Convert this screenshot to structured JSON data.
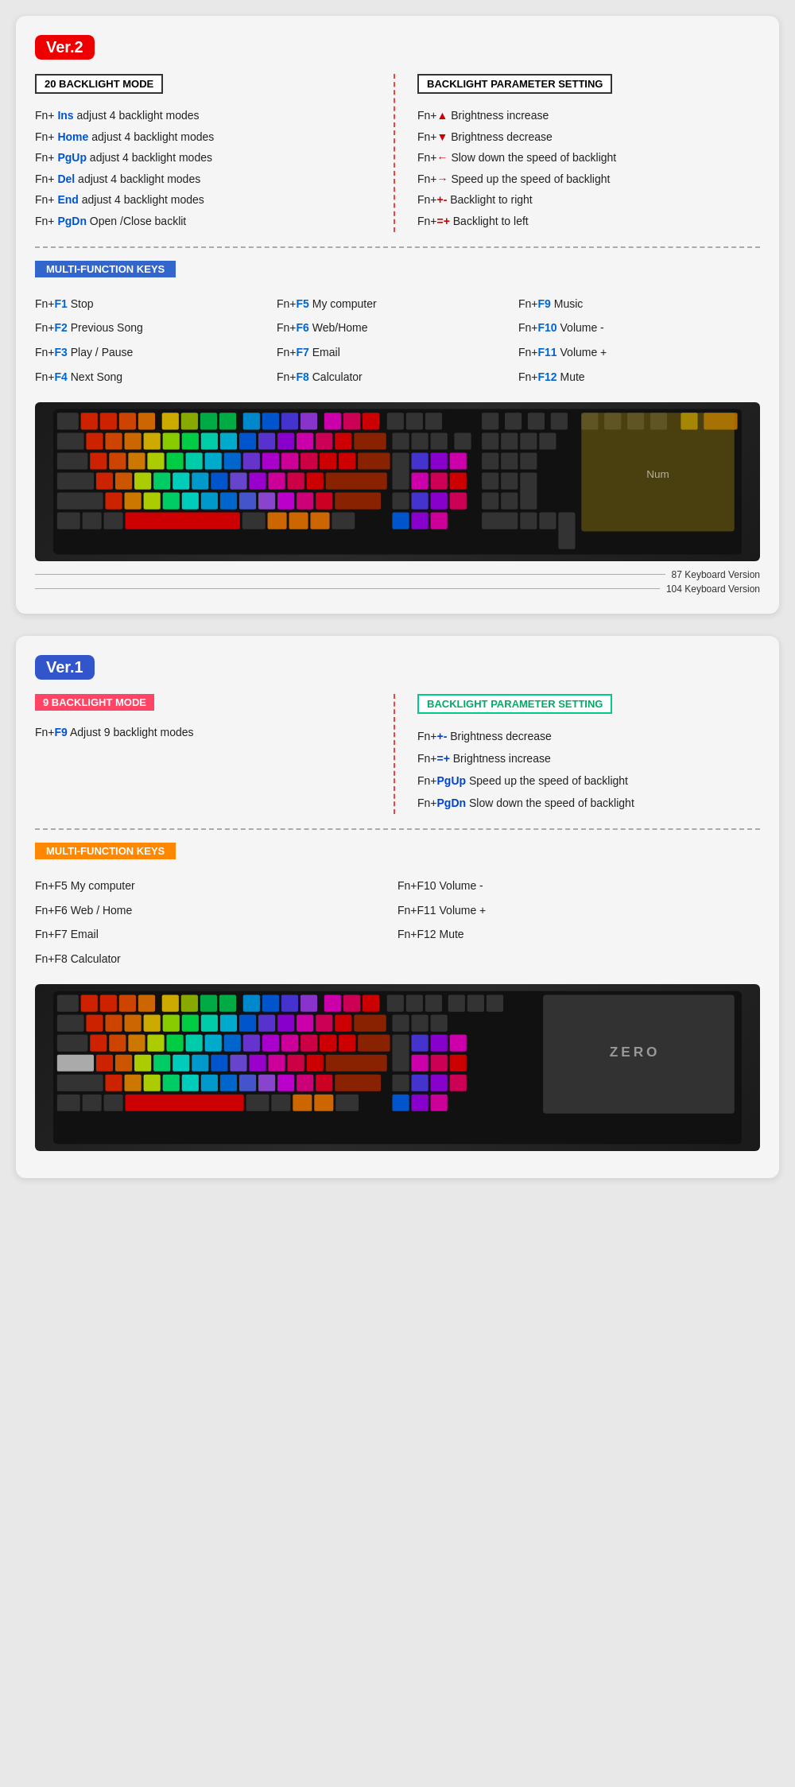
{
  "ver2": {
    "badge": "Ver.2",
    "backlight_section": {
      "header": "20 BACKLIGHT MODE",
      "rows": [
        {
          "prefix": "Fn+",
          "key": "Ins",
          "text": " adjust 4 backlight modes"
        },
        {
          "prefix": "Fn+",
          "key": "Home",
          "text": " adjust 4 backlight modes"
        },
        {
          "prefix": "Fn+",
          "key": "PgUp",
          "text": " adjust 4 backlight modes"
        },
        {
          "prefix": "Fn+",
          "key": "Del",
          "text": "  adjust 4 backlight modes"
        },
        {
          "prefix": "Fn+",
          "key": "End",
          "text": "  adjust 4 backlight modes"
        },
        {
          "prefix": "Fn+",
          "key": "PgDn",
          "text": " Open /Close backlit"
        }
      ]
    },
    "param_section": {
      "header": "BACKLIGHT PARAMETER SETTING",
      "rows": [
        {
          "prefix": "Fn+",
          "icon": "▲",
          "text": "  Brightness increase"
        },
        {
          "prefix": "Fn+",
          "icon": "▼",
          "text": "  Brightness decrease"
        },
        {
          "prefix": "Fn+",
          "icon": "←",
          "text": "  Slow down the speed of backlight"
        },
        {
          "prefix": "Fn+",
          "icon": "→",
          "text": "  Speed up the speed of backlight"
        },
        {
          "prefix": "Fn+",
          "icon": "+-",
          "text": "   Backlight to right"
        },
        {
          "prefix": "Fn+",
          "icon": "=+",
          "text": "   Backlight to left"
        }
      ]
    },
    "multifunction": {
      "header": "MULTI-FUNCTION KEYS",
      "items": [
        {
          "prefix": "Fn+",
          "key": "F1",
          "text": "  Stop"
        },
        {
          "prefix": "Fn+",
          "key": "F5",
          "text": "  My computer"
        },
        {
          "prefix": "Fn+",
          "key": "F9",
          "text": "   Music"
        },
        {
          "prefix": "Fn+",
          "key": "F2",
          "text": "  Previous Song"
        },
        {
          "prefix": "Fn+",
          "key": "F6",
          "text": "  Web/Home"
        },
        {
          "prefix": "Fn+",
          "key": "F10",
          "text": "  Volume -"
        },
        {
          "prefix": "Fn+",
          "key": "F3",
          "text": "  Play / Pause"
        },
        {
          "prefix": "Fn+",
          "key": "F7",
          "text": "  Email"
        },
        {
          "prefix": "Fn+",
          "key": "F11",
          "text": "  Volume +"
        },
        {
          "prefix": "Fn+",
          "key": "F4",
          "text": "  Next Song"
        },
        {
          "prefix": "Fn+",
          "key": "F8",
          "text": "  Calculator"
        },
        {
          "prefix": "Fn+",
          "key": "F12",
          "text": "  Mute"
        }
      ]
    },
    "versions": {
      "v87": "87 Keyboard Version",
      "v104": "104 Keyboard Version"
    }
  },
  "ver1": {
    "badge": "Ver.1",
    "backlight_section": {
      "header": "9 BACKLIGHT MODE",
      "rows": [
        {
          "prefix": "Fn+",
          "key": "F9",
          "text": "  Adjust 9 backlight modes"
        }
      ]
    },
    "param_section": {
      "header": "BACKLIGHT PARAMETER SETTING",
      "rows": [
        {
          "prefix": "Fn+",
          "icon": "+-",
          "text": "   Brightness decrease"
        },
        {
          "prefix": "Fn+",
          "icon": "=+",
          "text": "   Brightness increase"
        },
        {
          "prefix": "Fn+",
          "icon": "PgUp",
          "text": "  Speed up the speed of backlight"
        },
        {
          "prefix": "Fn+",
          "icon": "PgDn",
          "text": "  Slow down the speed of backlight"
        }
      ]
    },
    "multifunction": {
      "header": "MULTI-FUNCTION KEYS",
      "items": [
        {
          "prefix": "Fn+",
          "key": "F5",
          "text": "  My computer"
        },
        {
          "prefix": "Fn+",
          "key": "F10",
          "text": "  Volume -"
        },
        {
          "prefix": "Fn+",
          "key": "F6",
          "text": "  Web / Home"
        },
        {
          "prefix": "Fn+",
          "key": "F11",
          "text": "  Volume +"
        },
        {
          "prefix": "Fn+",
          "key": "F7",
          "text": "  Email"
        },
        {
          "prefix": "Fn+",
          "key": "F12",
          "text": "  Mute"
        },
        {
          "prefix": "Fn+",
          "key": "F8",
          "text": "  Calculator"
        },
        {
          "prefix": "",
          "key": "",
          "text": ""
        }
      ]
    }
  }
}
